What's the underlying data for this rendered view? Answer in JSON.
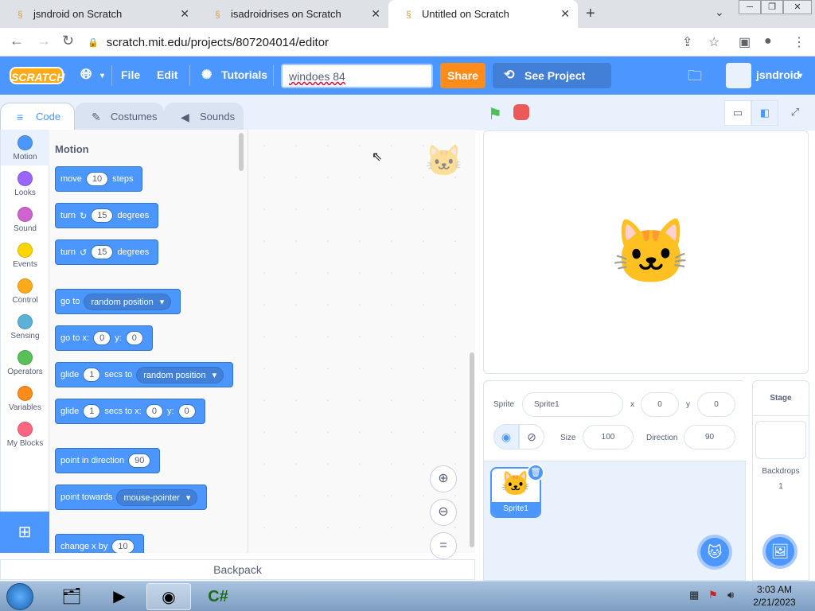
{
  "browser": {
    "tabs": [
      {
        "title": "jsndroid on Scratch"
      },
      {
        "title": "isadroidrises on Scratch"
      },
      {
        "title": "Untitled on Scratch"
      }
    ],
    "url": "scratch.mit.edu/projects/807204014/editor"
  },
  "menubar": {
    "logo": "SCRATCH",
    "file": "File",
    "edit": "Edit",
    "tutorials": "Tutorials",
    "project_title": "windoes 84",
    "share": "Share",
    "see_project": "See Project Page",
    "username": "jsndroid"
  },
  "editor_tabs": {
    "code": "Code",
    "costumes": "Costumes",
    "sounds": "Sounds"
  },
  "categories": [
    {
      "label": "Motion",
      "color": "#4c97ff"
    },
    {
      "label": "Looks",
      "color": "#9966ff"
    },
    {
      "label": "Sound",
      "color": "#cf63cf"
    },
    {
      "label": "Events",
      "color": "#ffd500"
    },
    {
      "label": "Control",
      "color": "#ffab19"
    },
    {
      "label": "Sensing",
      "color": "#5cb1d6"
    },
    {
      "label": "Operators",
      "color": "#59c059"
    },
    {
      "label": "Variables",
      "color": "#ff8c1a"
    },
    {
      "label": "My Blocks",
      "color": "#ff6680"
    }
  ],
  "palette": {
    "title": "Motion",
    "move": {
      "a": "move",
      "v": "10",
      "b": "steps"
    },
    "turn_right": {
      "a": "turn",
      "v": "15",
      "b": "degrees"
    },
    "turn_left": {
      "a": "turn",
      "v": "15",
      "b": "degrees"
    },
    "goto": {
      "a": "go to",
      "d": "random position"
    },
    "goto_xy": {
      "a": "go to x:",
      "x": "0",
      "b": "y:",
      "y": "0"
    },
    "glide": {
      "a": "glide",
      "v": "1",
      "b": "secs to",
      "d": "random position"
    },
    "glide_xy": {
      "a": "glide",
      "v": "1",
      "b": "secs to x:",
      "x": "0",
      "c": "y:",
      "y": "0"
    },
    "point_dir": {
      "a": "point in direction",
      "v": "90"
    },
    "point_towards": {
      "a": "point towards",
      "d": "mouse-pointer"
    },
    "change_x": {
      "a": "change x by",
      "v": "10"
    }
  },
  "backpack": "Backpack",
  "sprite_info": {
    "sprite_label": "Sprite",
    "sprite_name": "Sprite1",
    "x_label": "x",
    "x": "0",
    "y_label": "y",
    "y": "0",
    "size_label": "Size",
    "size": "100",
    "direction_label": "Direction",
    "direction": "90"
  },
  "sprite_list": [
    {
      "name": "Sprite1"
    }
  ],
  "stage_pane": {
    "title": "Stage",
    "backdrops_label": "Backdrops",
    "backdrops_count": "1"
  },
  "taskbar": {
    "time": "3:03 AM",
    "date": "2/21/2023"
  }
}
